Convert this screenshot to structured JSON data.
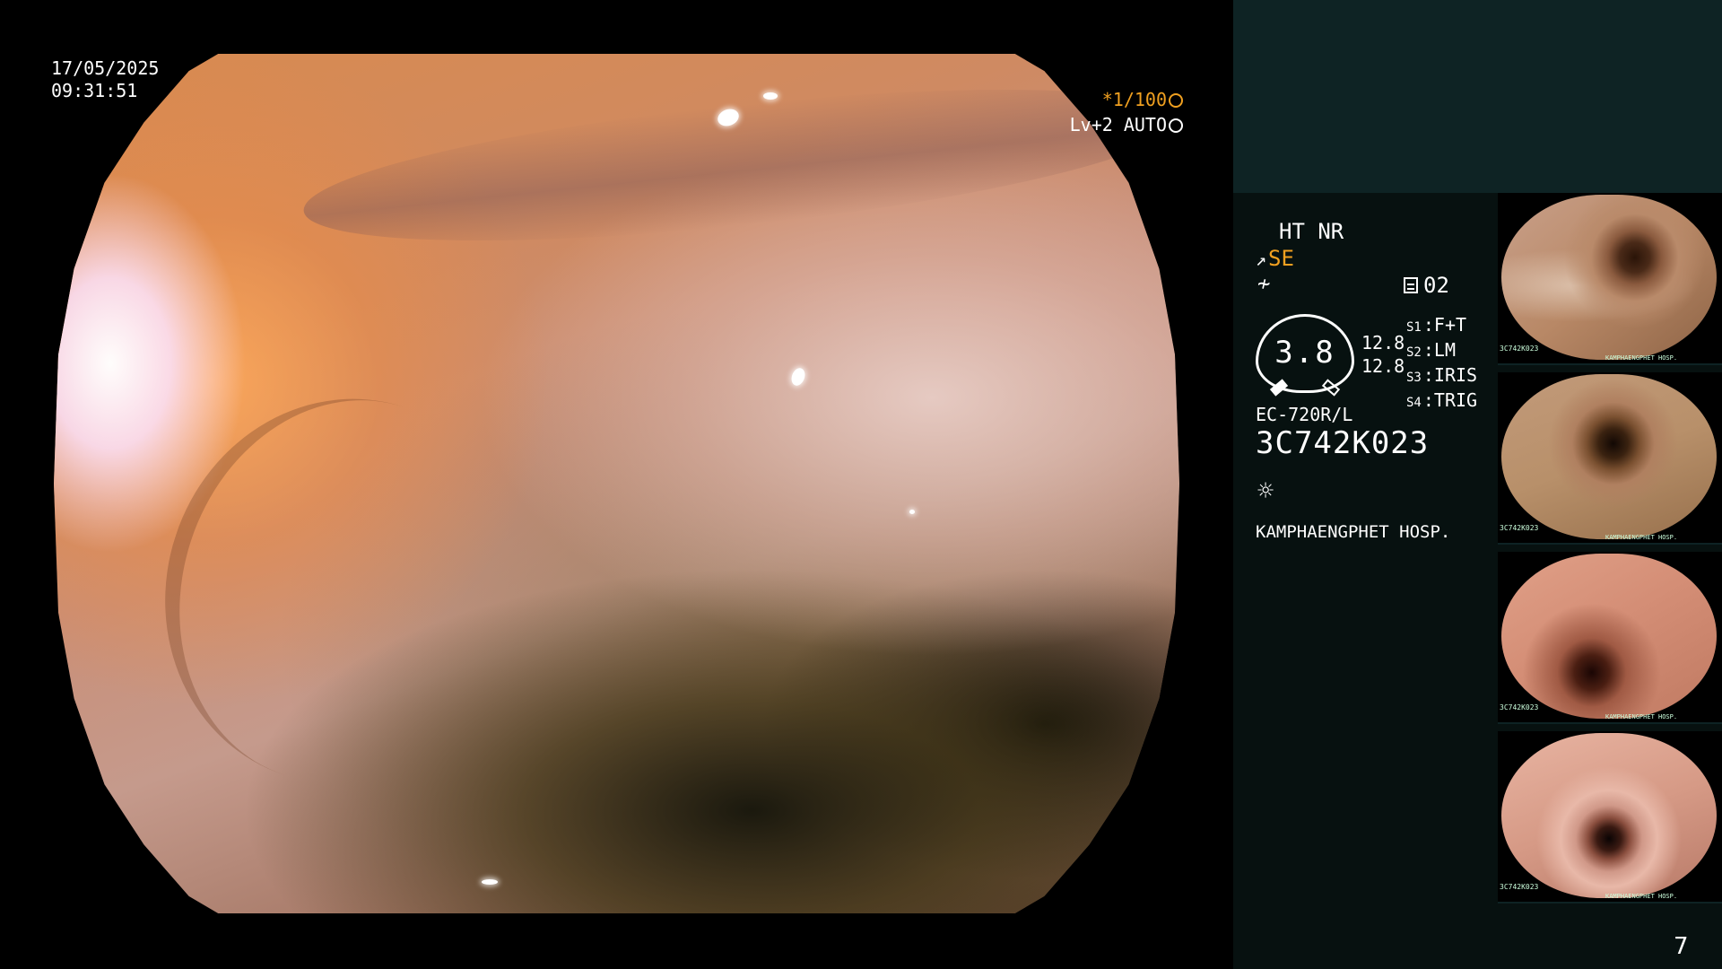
{
  "overlay": {
    "date": "17/05/2025",
    "time": "09:31:51",
    "shutter": "*1/100",
    "level": "Lv+2 AUTO"
  },
  "panel": {
    "ht_nr": "HT NR",
    "se_label": "SE",
    "memory_label": "02",
    "gauge_value": "3.8",
    "scale_top": "12.8",
    "scale_bottom": "12.8",
    "switches": [
      {
        "key": "S1",
        "value": "F+T"
      },
      {
        "key": "S2",
        "value": "LM"
      },
      {
        "key": "S3",
        "value": "IRIS"
      },
      {
        "key": "S4",
        "value": "TRIG"
      }
    ],
    "scope_model": "EC-720R/L",
    "scope_serial": "3C742K023",
    "hospital": "KAMPHAENGPHET HOSP."
  },
  "thumbnails": [
    {
      "serial": "3C742K023",
      "hospital": "KAMPHAENGPHET HOSP."
    },
    {
      "serial": "3C742K023",
      "hospital": "KAMPHAENGPHET HOSP."
    },
    {
      "serial": "3C742K023",
      "hospital": "KAMPHAENGPHET HOSP."
    },
    {
      "serial": "3C742K023",
      "hospital": "KAMPHAENGPHET HOSP."
    }
  ],
  "page_number": "7",
  "icons": {
    "shutter": "aperture-icon",
    "level": "auto-iris-icon",
    "se": "structure-enhance-icon",
    "tilde": "color-tone-icon",
    "memory": "memory-card-icon",
    "sun": "light-source-icon"
  },
  "colors": {
    "accent": "#f0a020",
    "panel_bg": "#071110",
    "panel_top_bg": "#0e2324"
  }
}
